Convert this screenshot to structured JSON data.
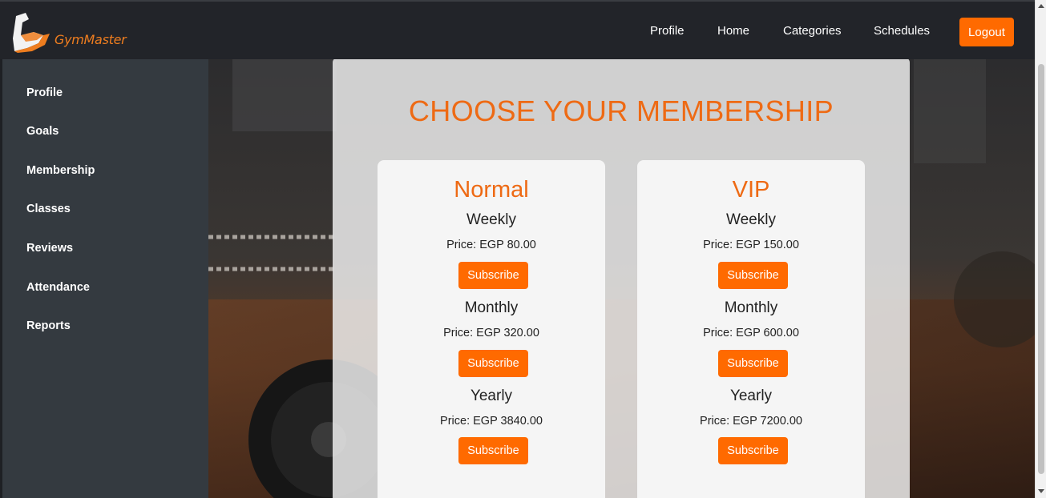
{
  "brand": {
    "name": "GymMaster",
    "accent": "#ff6a00"
  },
  "nav": {
    "links": [
      "Profile",
      "Home",
      "Categories",
      "Schedules"
    ],
    "logout": "Logout"
  },
  "sidebar": {
    "items": [
      {
        "label": "Profile"
      },
      {
        "label": "Goals"
      },
      {
        "label": "Membership"
      },
      {
        "label": "Classes"
      },
      {
        "label": "Reviews"
      },
      {
        "label": "Attendance"
      },
      {
        "label": "Reports"
      }
    ]
  },
  "main": {
    "title": "CHOOSE YOUR MEMBERSHIP",
    "plans": [
      {
        "name": "Normal",
        "options": [
          {
            "period": "Weekly",
            "price": "Price: EGP 80.00",
            "button": "Subscribe"
          },
          {
            "period": "Monthly",
            "price": "Price: EGP 320.00",
            "button": "Subscribe"
          },
          {
            "period": "Yearly",
            "price": "Price: EGP 3840.00",
            "button": "Subscribe"
          }
        ]
      },
      {
        "name": "VIP",
        "options": [
          {
            "period": "Weekly",
            "price": "Price: EGP 150.00",
            "button": "Subscribe"
          },
          {
            "period": "Monthly",
            "price": "Price: EGP 600.00",
            "button": "Subscribe"
          },
          {
            "period": "Yearly",
            "price": "Price: EGP 7200.00",
            "button": "Subscribe"
          }
        ]
      }
    ]
  }
}
